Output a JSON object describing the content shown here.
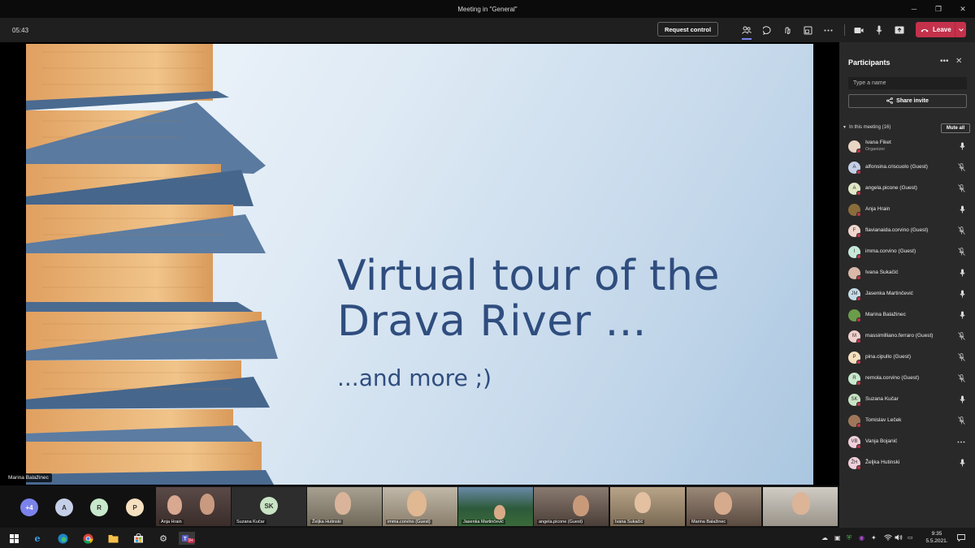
{
  "window": {
    "title": "Meeting in \"General\"",
    "minimize": "─",
    "restore": "❐",
    "close": "✕"
  },
  "toolbar": {
    "timer": "05:43",
    "request_control": "Request control",
    "leave": "Leave"
  },
  "slide": {
    "title_line1": "Virtual tour of the",
    "title_line2": "Drava River ...",
    "subtitle": "...and more ;)",
    "presenter": "Marina Balažinec"
  },
  "panel": {
    "title": "Participants",
    "search_placeholder": "Type a name",
    "share_invite": "Share invite",
    "section": "In this meeting (16)",
    "mute_all": "Mute all",
    "participants": [
      {
        "name": "Ivana Fiket",
        "role": "Organizer",
        "initials": "",
        "color": "#e8d5c4",
        "mic": "on"
      },
      {
        "name": "alfonsina.criscuolo (Guest)",
        "role": "",
        "initials": "A",
        "color": "#c5cfe8",
        "mic": "muted"
      },
      {
        "name": "angela.picone (Guest)",
        "role": "",
        "initials": "A",
        "color": "#e0e8c5",
        "mic": "muted"
      },
      {
        "name": "Anja Hrain",
        "role": "",
        "initials": "",
        "color": "#8a6d3b",
        "mic": "on"
      },
      {
        "name": "flavianaida.corvino (Guest)",
        "role": "",
        "initials": "F",
        "color": "#f0d5cc",
        "mic": "muted"
      },
      {
        "name": "imma.corvino (Guest)",
        "role": "",
        "initials": "I",
        "color": "#c5e8d9",
        "mic": "muted"
      },
      {
        "name": "Ivana Sukačić",
        "role": "",
        "initials": "",
        "color": "#d9b8a8",
        "mic": "on"
      },
      {
        "name": "Jasenka Martinčević",
        "role": "",
        "initials": "JM",
        "color": "#c5dce8",
        "mic": "on"
      },
      {
        "name": "Marina Balažinec",
        "role": "",
        "initials": "",
        "color": "#6b9c4a",
        "mic": "on"
      },
      {
        "name": "massimilliano.ferraro (Guest)",
        "role": "",
        "initials": "M",
        "color": "#f0d0cc",
        "mic": "muted"
      },
      {
        "name": "pina.cipullo (Guest)",
        "role": "",
        "initials": "P",
        "color": "#f5e0c0",
        "mic": "muted"
      },
      {
        "name": "remola.corvino (Guest)",
        "role": "",
        "initials": "R",
        "color": "#c8e8cc",
        "mic": "muted"
      },
      {
        "name": "Suzana Kučar",
        "role": "",
        "initials": "SK",
        "color": "#c9e4c5",
        "mic": "on"
      },
      {
        "name": "Tomislav Leček",
        "role": "",
        "initials": "",
        "color": "#a0765a",
        "mic": "muted"
      },
      {
        "name": "Vanja Bojanić",
        "role": "",
        "initials": "VB",
        "color": "#f0d0dc",
        "mic": "more"
      },
      {
        "name": "Željka Hutinski",
        "role": "",
        "initials": "ŽH",
        "color": "#f0d0dc",
        "mic": "on"
      }
    ]
  },
  "strip": {
    "overflow": "+4",
    "bubbles": [
      "A",
      "R",
      "P"
    ],
    "tiles": [
      {
        "name": "Anja Hrain"
      },
      {
        "name": "Suzana Kučar",
        "initials": "SK"
      },
      {
        "name": "Željka Hutinski"
      },
      {
        "name": "imma.corvino (Guest)"
      },
      {
        "name": "Jasenka Martinčević"
      },
      {
        "name": "angela.picone (Guest)"
      },
      {
        "name": "Ivana Sukačić"
      },
      {
        "name": "Marina Balažinec"
      },
      {
        "name": ""
      }
    ]
  },
  "taskbar": {
    "time": "9:35",
    "date": "5.5.2021.",
    "badge": "9+"
  }
}
